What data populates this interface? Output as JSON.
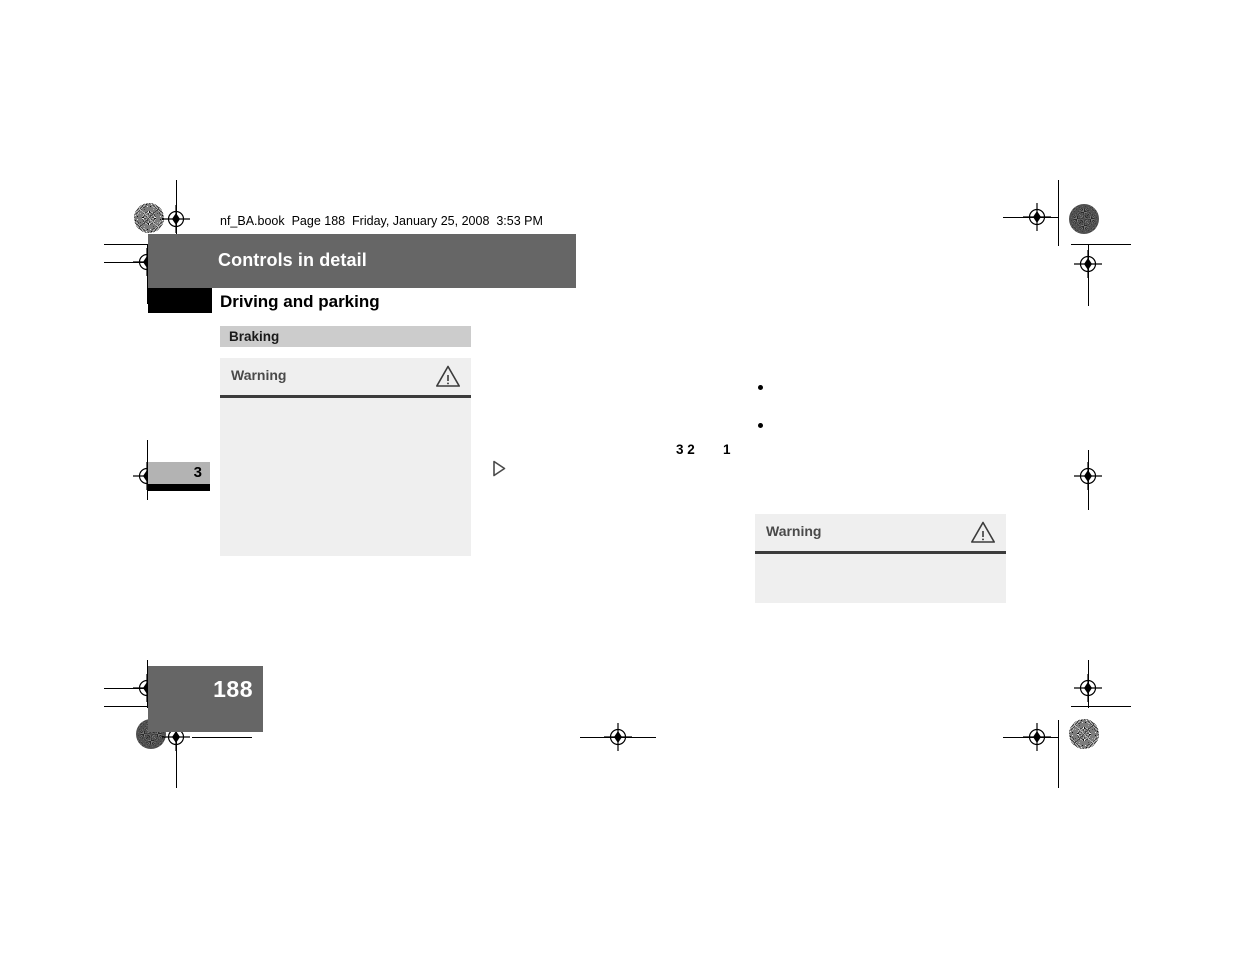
{
  "document": {
    "file_info": "nf_BA.book  Page 188  Friday, January 25, 2008  3:53 PM",
    "page_number": "188",
    "chapter_tab_number": "3"
  },
  "header": {
    "chapter_title": "Controls in detail",
    "section_title": "Driving and parking"
  },
  "subsection": {
    "label": "Braking"
  },
  "warnings": [
    {
      "label": "Warning",
      "icon": "warning-triangle-icon",
      "body": ""
    },
    {
      "label": "Warning",
      "icon": "warning-triangle-icon",
      "body": ""
    }
  ],
  "markers": {
    "continuation": "continuation-triangle-icon"
  },
  "right_column": {
    "bullets": [
      "",
      ""
    ],
    "callouts": [
      {
        "text": "3 2"
      },
      {
        "text": "1"
      }
    ]
  },
  "colors": {
    "banner_gray": "#666666",
    "subsection_gray": "#cccccc",
    "box_gray": "#efefef",
    "rule_dark": "#3b3b3b",
    "black": "#000000",
    "white": "#ffffff",
    "tab_gray": "#b3b3b3"
  }
}
